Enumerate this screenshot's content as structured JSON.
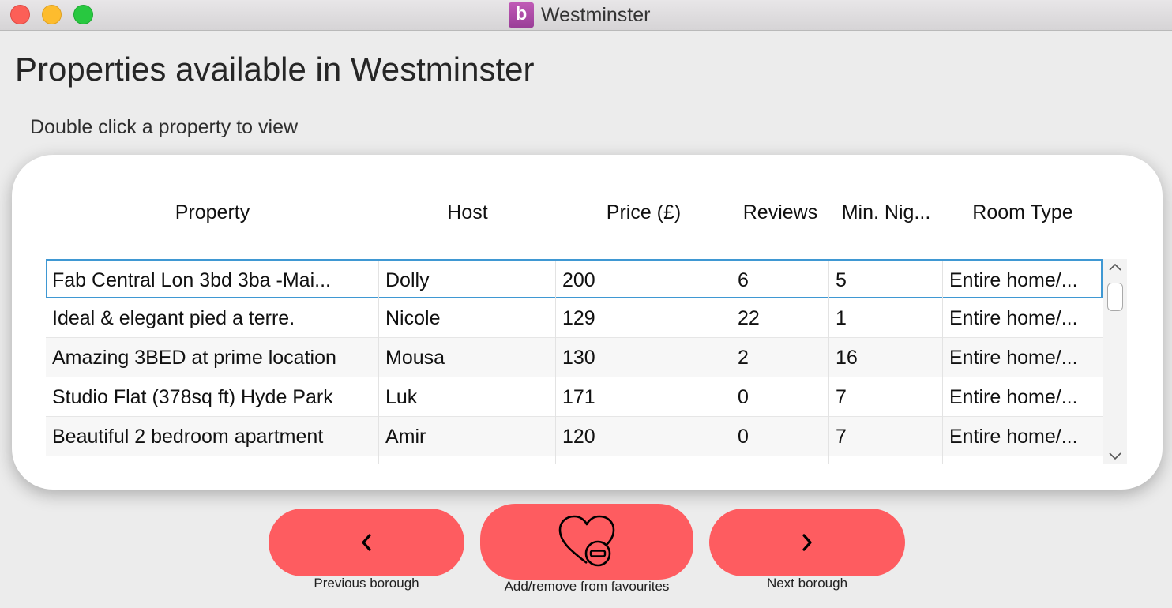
{
  "window": {
    "title": "Westminster",
    "app_icon_letter": "b",
    "app_icon_color": "#b04ea8"
  },
  "page": {
    "heading": "Properties available in Westminster",
    "instruction": "Double click a property to view"
  },
  "table": {
    "columns": [
      "Property",
      "Host",
      "Price (£)",
      "Reviews",
      "Min. Nig...",
      "Room Type"
    ],
    "selected_row": 0,
    "rows": [
      [
        "Fab Central Lon 3bd 3ba -Mai...",
        "Dolly",
        "200",
        "6",
        "5",
        "Entire home/..."
      ],
      [
        "Ideal & elegant pied a terre.",
        "Nicole",
        "129",
        "22",
        "1",
        "Entire home/..."
      ],
      [
        "Amazing 3BED at prime location",
        "Mousa",
        "130",
        "2",
        "16",
        "Entire home/..."
      ],
      [
        "Studio Flat (378sq ft) Hyde Park",
        "Luk",
        "171",
        "0",
        "7",
        "Entire home/..."
      ],
      [
        "Beautiful 2 bedroom apartment",
        "Amir",
        "120",
        "0",
        "7",
        "Entire home/..."
      ],
      [
        "",
        "",
        "",
        "",
        "",
        ""
      ]
    ]
  },
  "buttons": {
    "previous_label": "Previous borough",
    "favourite_label": "Add/remove from favourites",
    "next_label": "Next borough",
    "previous_icon": "chevron-left-icon",
    "favourite_icon": "heart-remove-icon",
    "next_icon": "chevron-right-icon",
    "color": "#fe5c60"
  },
  "colors": {
    "selection_border": "#3f98d3",
    "card_background": "#ffffff",
    "window_background": "#ececec"
  }
}
